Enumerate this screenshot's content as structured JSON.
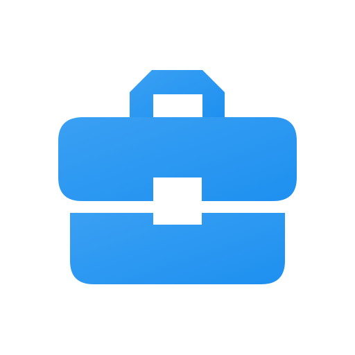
{
  "icon": {
    "name": "briefcase-icon",
    "colors": {
      "gradient_start": "#3aa0f3",
      "gradient_end": "#1e90f0",
      "background": "#ffffff"
    }
  }
}
